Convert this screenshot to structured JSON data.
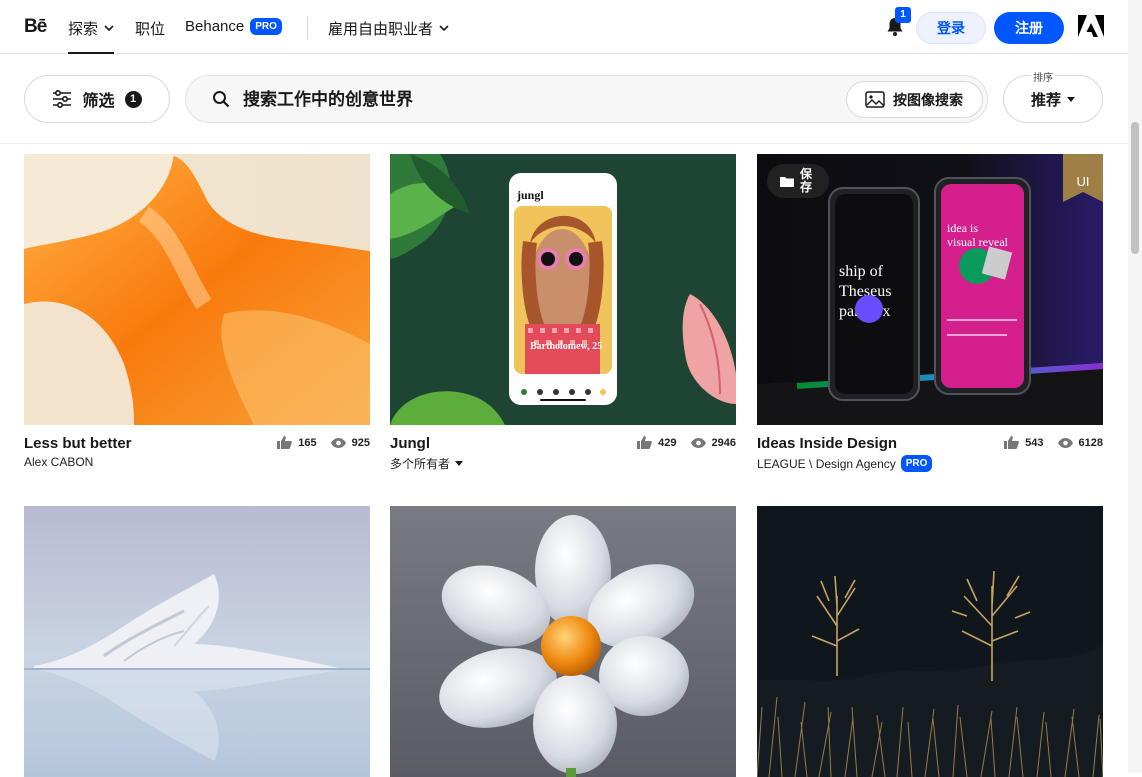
{
  "nav": {
    "logo": "Bē",
    "explore": "探索",
    "jobs": "职位",
    "behance": "Behance",
    "pro": "PRO",
    "hire": "雇用自由职业者",
    "notification_count": "1",
    "login": "登录",
    "signup": "注册"
  },
  "filter": {
    "label": "筛选",
    "count": "1"
  },
  "search": {
    "placeholder": "搜索工作中的创意世界",
    "image_search": "按图像搜索"
  },
  "sort": {
    "label": "排序",
    "value": "推荐"
  },
  "cards": [
    {
      "title": "Less but better",
      "owner": "Alex CABON",
      "likes": "165",
      "views": "925"
    },
    {
      "title": "Jungl",
      "owner": "多个所有者",
      "likes": "429",
      "views": "2946",
      "phone_brand": "jungl",
      "phone_caption": "Bartholomew, 25"
    },
    {
      "title": "Ideas Inside Design",
      "owner": "LEAGUE \\ Design Agency",
      "owner_badge": "PRO",
      "likes": "543",
      "views": "6128",
      "save_label": "保存",
      "corner_tag": "UI",
      "phone_text_left": "ship of Theseus paradox",
      "phone_text_right": "idea is visual reveal"
    },
    {
      "title": "",
      "owner": ""
    },
    {
      "title": "",
      "owner": ""
    },
    {
      "title": "",
      "owner": ""
    }
  ],
  "colors": {
    "accent": "#0057ff",
    "text": "#191919"
  }
}
